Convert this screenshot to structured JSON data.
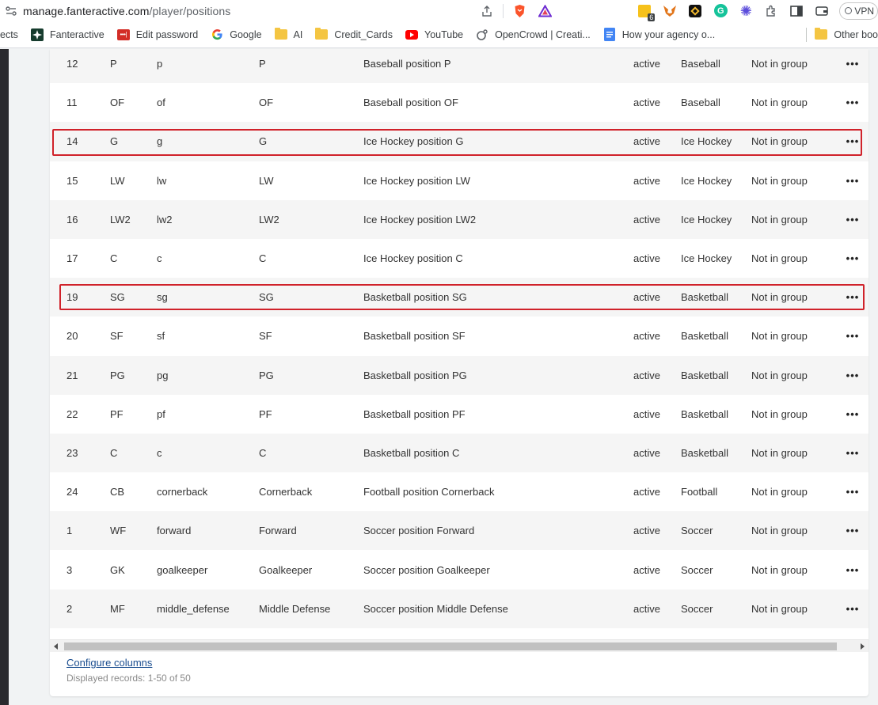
{
  "browser": {
    "url_host": "manage.fanteractive.com",
    "url_path": "/player/positions",
    "extension_badge": "6",
    "vpn_label": "VPN"
  },
  "bookmarks": [
    {
      "label": "ects",
      "icon": "folder-icon-partial"
    },
    {
      "label": "Fanteractive",
      "icon": "fanteractive-icon"
    },
    {
      "label": "Edit password",
      "icon": "lastpass-icon"
    },
    {
      "label": "Google",
      "icon": "google-icon"
    },
    {
      "label": "AI",
      "icon": "folder-icon"
    },
    {
      "label": "Credit_Cards",
      "icon": "folder-icon"
    },
    {
      "label": "YouTube",
      "icon": "youtube-icon"
    },
    {
      "label": "OpenCrowd | Creati...",
      "icon": "opencrowd-icon"
    },
    {
      "label": "How your agency o...",
      "icon": "docs-icon"
    }
  ],
  "other_bookmarks_label": "Other boo",
  "table": {
    "rows": [
      {
        "id": "12",
        "code": "P",
        "key": "p",
        "name": "P",
        "description": "Baseball position P",
        "status": "active",
        "sport": "Baseball",
        "group": "Not in group"
      },
      {
        "id": "11",
        "code": "OF",
        "key": "of",
        "name": "OF",
        "description": "Baseball position OF",
        "status": "active",
        "sport": "Baseball",
        "group": "Not in group"
      },
      {
        "id": "14",
        "code": "G",
        "key": "g",
        "name": "G",
        "description": "Ice Hockey position G",
        "status": "active",
        "sport": "Ice Hockey",
        "group": "Not in group"
      },
      {
        "id": "15",
        "code": "LW",
        "key": "lw",
        "name": "LW",
        "description": "Ice Hockey position LW",
        "status": "active",
        "sport": "Ice Hockey",
        "group": "Not in group"
      },
      {
        "id": "16",
        "code": "LW2",
        "key": "lw2",
        "name": "LW2",
        "description": "Ice Hockey position LW2",
        "status": "active",
        "sport": "Ice Hockey",
        "group": "Not in group"
      },
      {
        "id": "17",
        "code": "C",
        "key": "c",
        "name": "C",
        "description": "Ice Hockey position C",
        "status": "active",
        "sport": "Ice Hockey",
        "group": "Not in group"
      },
      {
        "id": "19",
        "code": "SG",
        "key": "sg",
        "name": "SG",
        "description": "Basketball position SG",
        "status": "active",
        "sport": "Basketball",
        "group": "Not in group"
      },
      {
        "id": "20",
        "code": "SF",
        "key": "sf",
        "name": "SF",
        "description": "Basketball position SF",
        "status": "active",
        "sport": "Basketball",
        "group": "Not in group"
      },
      {
        "id": "21",
        "code": "PG",
        "key": "pg",
        "name": "PG",
        "description": "Basketball position PG",
        "status": "active",
        "sport": "Basketball",
        "group": "Not in group"
      },
      {
        "id": "22",
        "code": "PF",
        "key": "pf",
        "name": "PF",
        "description": "Basketball position PF",
        "status": "active",
        "sport": "Basketball",
        "group": "Not in group"
      },
      {
        "id": "23",
        "code": "C",
        "key": "c",
        "name": "C",
        "description": "Basketball position C",
        "status": "active",
        "sport": "Basketball",
        "group": "Not in group"
      },
      {
        "id": "24",
        "code": "CB",
        "key": "cornerback",
        "name": "Cornerback",
        "description": "Football position Cornerback",
        "status": "active",
        "sport": "Football",
        "group": "Not in group"
      },
      {
        "id": "1",
        "code": "WF",
        "key": "forward",
        "name": "Forward",
        "description": "Soccer position Forward",
        "status": "active",
        "sport": "Soccer",
        "group": "Not in group"
      },
      {
        "id": "3",
        "code": "GK",
        "key": "goalkeeper",
        "name": "Goalkeeper",
        "description": "Soccer position Goalkeeper",
        "status": "active",
        "sport": "Soccer",
        "group": "Not in group"
      },
      {
        "id": "2",
        "code": "MF",
        "key": "middle_defense",
        "name": "Middle Defense",
        "description": "Soccer position Middle Defense",
        "status": "active",
        "sport": "Soccer",
        "group": "Not in group"
      },
      {
        "id": "",
        "code": "",
        "key": "",
        "name": "",
        "description": "",
        "status": "",
        "sport": "",
        "group": ""
      }
    ],
    "row_menu_glyph": "•••",
    "highlight_color": "#d0222a"
  },
  "footer": {
    "configure_label": "Configure columns",
    "displayed_label": "Displayed records: 1-50 of 50"
  }
}
